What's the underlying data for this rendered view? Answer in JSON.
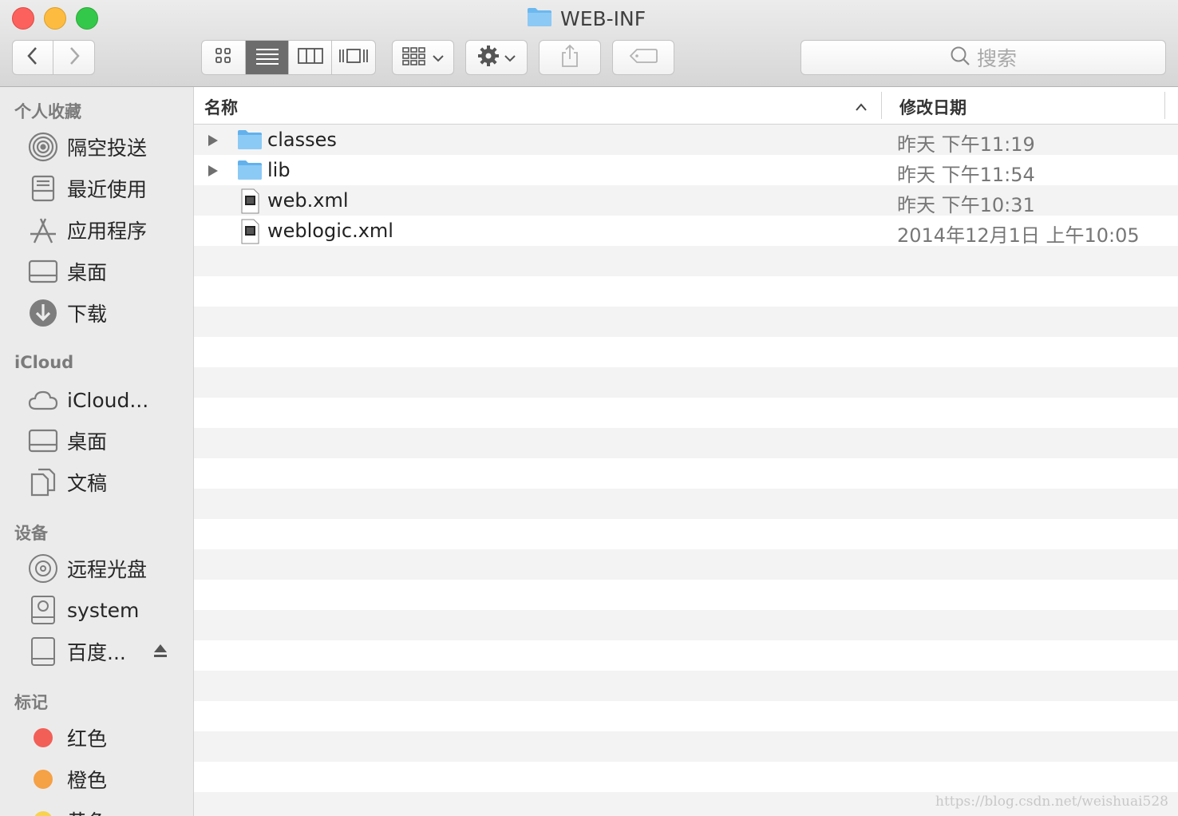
{
  "window": {
    "title": "WEB-INF"
  },
  "toolbar": {
    "search_placeholder": "搜索"
  },
  "sidebar": {
    "sections": [
      {
        "header": "个人收藏",
        "items": [
          {
            "label": "隔空投送",
            "icon": "airdrop-icon"
          },
          {
            "label": "最近使用",
            "icon": "recents-icon"
          },
          {
            "label": "应用程序",
            "icon": "applications-icon"
          },
          {
            "label": "桌面",
            "icon": "desktop-icon"
          },
          {
            "label": "下载",
            "icon": "downloads-icon"
          }
        ]
      },
      {
        "header": "iCloud",
        "items": [
          {
            "label": "iCloud...",
            "icon": "icloud-icon"
          },
          {
            "label": "桌面",
            "icon": "desktop-icon"
          },
          {
            "label": "文稿",
            "icon": "documents-icon"
          }
        ]
      },
      {
        "header": "设备",
        "items": [
          {
            "label": "远程光盘",
            "icon": "disc-icon"
          },
          {
            "label": "system",
            "icon": "hard-drive-icon"
          },
          {
            "label": "百度...",
            "icon": "external-drive-icon"
          }
        ]
      },
      {
        "header": "标记",
        "items": [
          {
            "label": "红色",
            "color": "#f25f56"
          },
          {
            "label": "橙色",
            "color": "#f5a145"
          },
          {
            "label": "黄色",
            "color": "#f7d34f"
          }
        ]
      }
    ]
  },
  "list": {
    "columns": {
      "name": "名称",
      "date": "修改日期"
    },
    "sort": "name-ascending",
    "rows": [
      {
        "name": "classes",
        "date": "昨天 下午11:19",
        "kind": "folder"
      },
      {
        "name": "lib",
        "date": "昨天 下午11:54",
        "kind": "folder"
      },
      {
        "name": "web.xml",
        "date": "昨天 下午10:31",
        "kind": "xml"
      },
      {
        "name": "weblogic.xml",
        "date": "2014年12月1日 上午10:05",
        "kind": "xml"
      }
    ]
  },
  "watermark": "https://blog.csdn.net/weishuai528"
}
